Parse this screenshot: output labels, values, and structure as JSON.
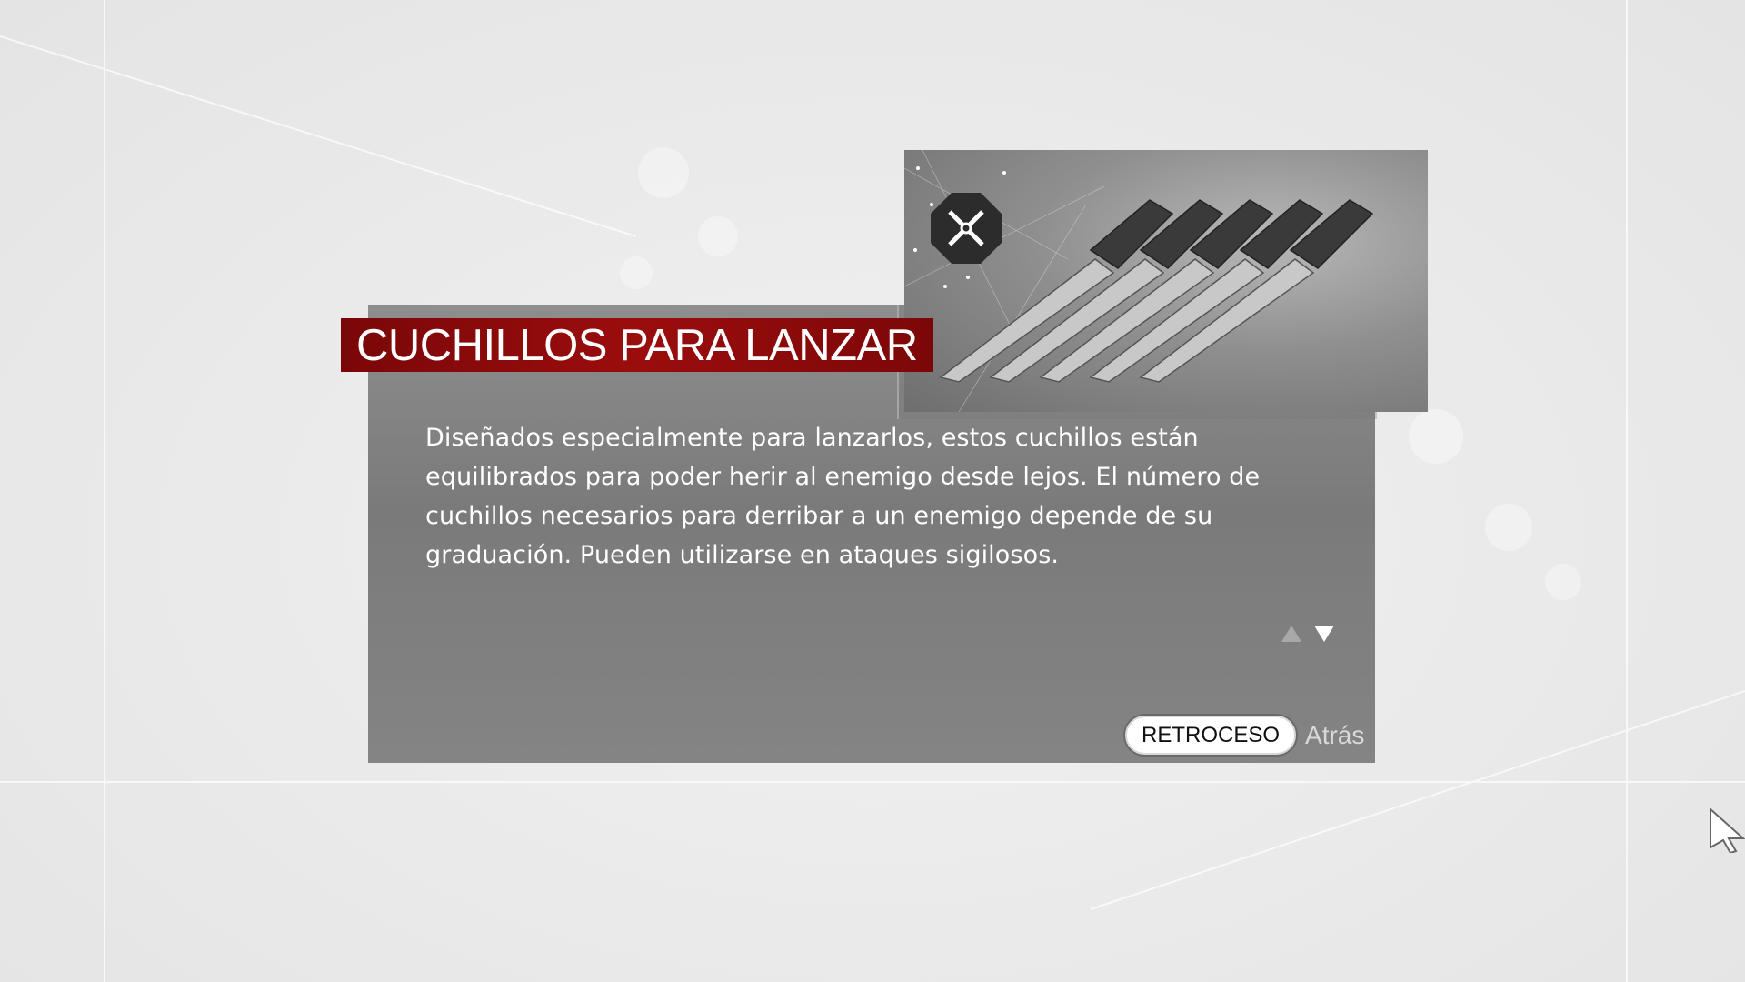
{
  "item": {
    "title": "CUCHILLOS PARA LANZAR",
    "description": "Diseñados especialmente para lanzarlos, estos cuchillos están equilibrados para poder herir al enemigo desde lejos. El número de cuchillos necesarios para derribar a un enemigo depende de su graduación. Pueden utilizarse en ataques sigilosos.",
    "image_icon": "throwing-knives-illustration",
    "badge_icon": "crossed-daggers-icon"
  },
  "controls": {
    "back_key": "RETROCESO",
    "back_label": "Atrás",
    "scroll_up_icon": "arrow-up-icon",
    "scroll_down_icon": "arrow-down-icon"
  },
  "colors": {
    "title_bar": "#9b0d0d",
    "panel": "#7f7f7f",
    "background": "#ececec"
  }
}
